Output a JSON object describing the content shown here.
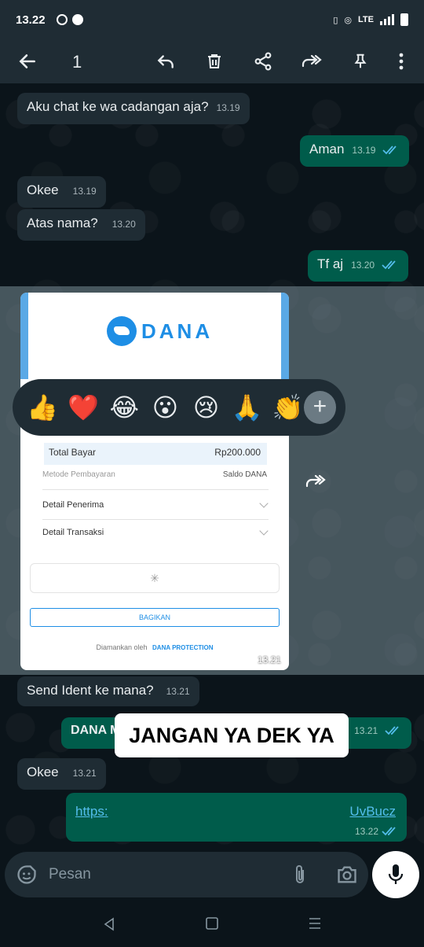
{
  "status_bar": {
    "time": "13.22",
    "net_label": "LTE"
  },
  "top_bar": {
    "selected_count": "1"
  },
  "messages": [
    {
      "dir": "in",
      "text": "Aku chat ke wa cadangan aja?",
      "time": "13.19"
    },
    {
      "dir": "out",
      "text": "Aman",
      "time": "13.19"
    },
    {
      "dir": "in",
      "text": "Okee",
      "time": "13.19"
    },
    {
      "dir": "in",
      "text": "Atas nama?",
      "time": "13.20"
    },
    {
      "dir": "out",
      "text": "Tf aj",
      "time": "13.20"
    },
    {
      "dir": "in",
      "text": "Send Ident ke mana?",
      "time": "13.21"
    },
    {
      "dir": "out",
      "text": "DANA MASUK JOIN PARTNER NAGI -NOREFF",
      "time": "13.21"
    },
    {
      "dir": "in",
      "text": "Okee",
      "time": "13.21"
    },
    {
      "dir": "out",
      "text_start": "https:",
      "text_end": "UvBucz",
      "time": "13.22"
    }
  ],
  "image_message": {
    "time": "13.21",
    "brand": "DANA",
    "total_label": "Total Bayar",
    "total_value": "Rp200.000",
    "method_label": "Metode Pembayaran",
    "method_value": "Saldo DANA",
    "receiver_label": "Detail Penerima",
    "transaction_label": "Detail Transaksi",
    "share_label": "BAGIKAN",
    "secured_by": "Diamankan oleh",
    "protection": "DANA PROTECTION"
  },
  "reactions": [
    "👍",
    "❤️",
    "😂",
    "😮",
    "😢",
    "🙏",
    "👏"
  ],
  "reaction_more": "+",
  "sticker": {
    "text": "JANGAN YA DEK YA"
  },
  "composer": {
    "placeholder": "Pesan"
  },
  "colors": {
    "incoming": "#1f2c34",
    "outgoing": "#005c4b",
    "read_ticks": "#53bdeb"
  }
}
